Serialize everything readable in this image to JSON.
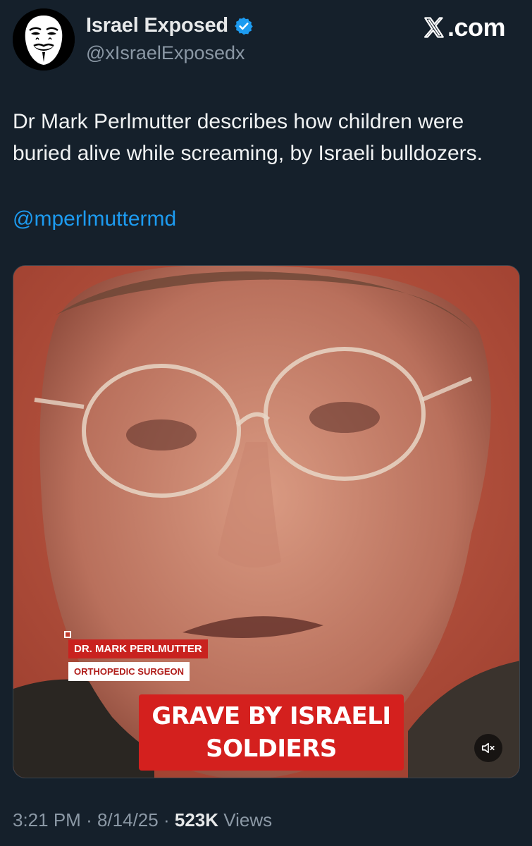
{
  "author": {
    "display_name": "Israel Exposed",
    "handle": "@xIsraelExposedx",
    "avatar_icon": "guy-fawkes-mask-icon",
    "verified_icon": "verified-badge-icon",
    "verified_color": "#1d9bf0"
  },
  "brand": {
    "label": ".com",
    "icon": "x-logo-icon"
  },
  "tweet": {
    "text": "Dr Mark Perlmutter describes how children were buried alive while screaming, by Israeli bulldozers.",
    "mention": "@mperlmuttermd",
    "mention_color": "#1d9bf0"
  },
  "media": {
    "type": "video",
    "lower_third_name": "DR. MARK PERLMUTTER",
    "lower_third_title": "ORTHOPEDIC SURGEON",
    "caption_line1": "GRAVE BY ISRAELI",
    "caption_line2": "SOLDIERS",
    "mute_icon": "speaker-muted-icon"
  },
  "meta": {
    "time": "3:21 PM",
    "separator": "·",
    "date": "8/14/25",
    "views_count": "523K",
    "views_label": "Views"
  },
  "colors": {
    "background": "#15202b",
    "text": "#e7e9ea",
    "secondary_text": "#8b98a5",
    "caption_red": "#d4201e"
  }
}
